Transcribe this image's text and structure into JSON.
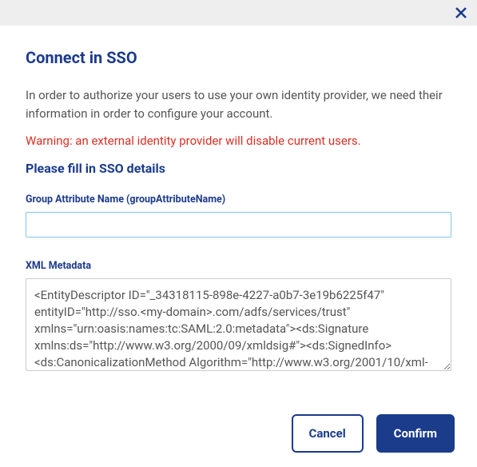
{
  "dialog": {
    "title": "Connect in SSO",
    "description": "In order to authorize your users to use your own identity provider, we need their information in order to configure your account.",
    "warning": "Warning: an external identity provider will disable current users.",
    "subtitle": "Please fill in SSO details",
    "fields": {
      "groupAttributeName": {
        "label": "Group Attribute Name (groupAttributeName)",
        "value": ""
      },
      "xmlMetadata": {
        "label": "XML Metadata",
        "value": "<EntityDescriptor ID=\"_34318115-898e-4227-a0b7-3e19b6225f47\" entityID=\"http://sso.<my-domain>.com/adfs/services/trust\" xmlns=\"urn:oasis:names:tc:SAML:2.0:metadata\"><ds:Signature xmlns:ds=\"http://www.w3.org/2000/09/xmldsig#\"><ds:SignedInfo><ds:CanonicalizationMethod Algorithm=\"http://www.w3.org/2001/10/xml-"
      }
    },
    "buttons": {
      "cancel": "Cancel",
      "confirm": "Confirm"
    }
  }
}
